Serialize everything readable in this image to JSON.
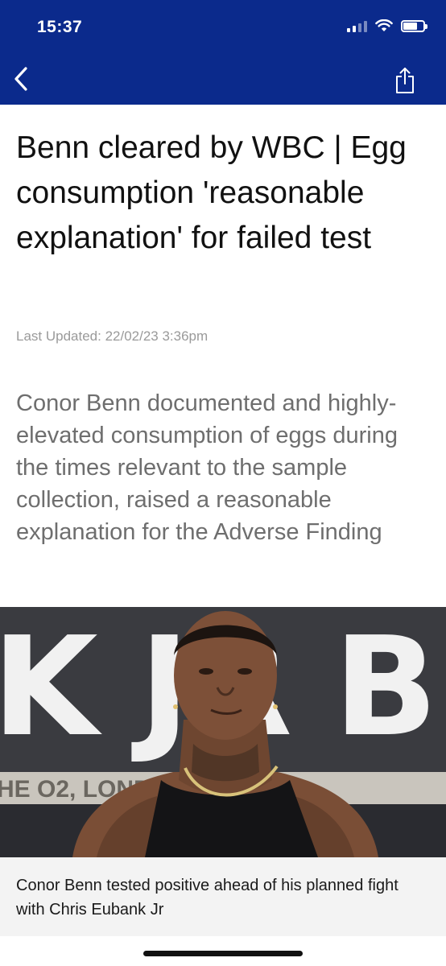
{
  "status_bar": {
    "time": "15:37"
  },
  "article": {
    "headline": "Benn cleared by WBC | Egg consumption 'reasonable explanation' for failed test",
    "last_updated": "Last Updated: 22/02/23 3:36pm",
    "standfirst": "Conor Benn documented and highly-elevated consumption of eggs during the times relevant to the sample collection, raised a reasonable explanation for the Adverse Finding",
    "image": {
      "backdrop_text": "K JR BEN",
      "banner_text": "HE O2, LOND",
      "caption": "Conor Benn tested positive ahead of his planned fight with Chris Eubank Jr"
    }
  },
  "colors": {
    "header_bg": "#0b2a8c",
    "caption_bg": "#f3f3f3"
  },
  "icons": {
    "back": "chevron-left-icon",
    "share": "share-icon"
  }
}
